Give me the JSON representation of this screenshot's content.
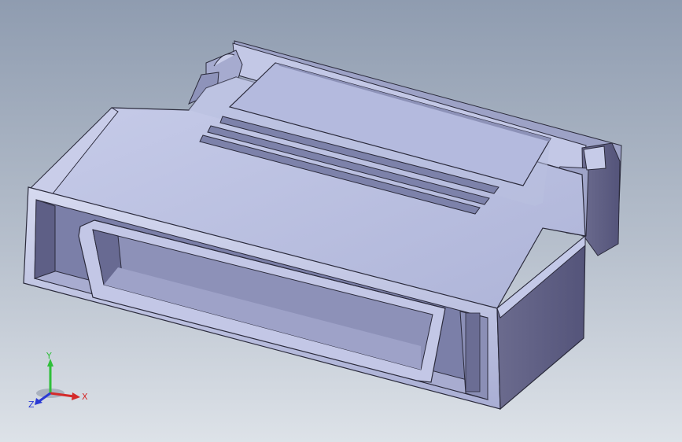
{
  "view_triad": {
    "x_label": "X",
    "y_label": "Y",
    "z_label": "Z",
    "x_color": "#d42a2a",
    "y_color": "#2fbf3a",
    "z_color": "#2a3ad4"
  },
  "model": {
    "face_color": "#bcc2e2",
    "shadow_color": "#6f6f96",
    "edge_color": "#2b2b3c"
  }
}
